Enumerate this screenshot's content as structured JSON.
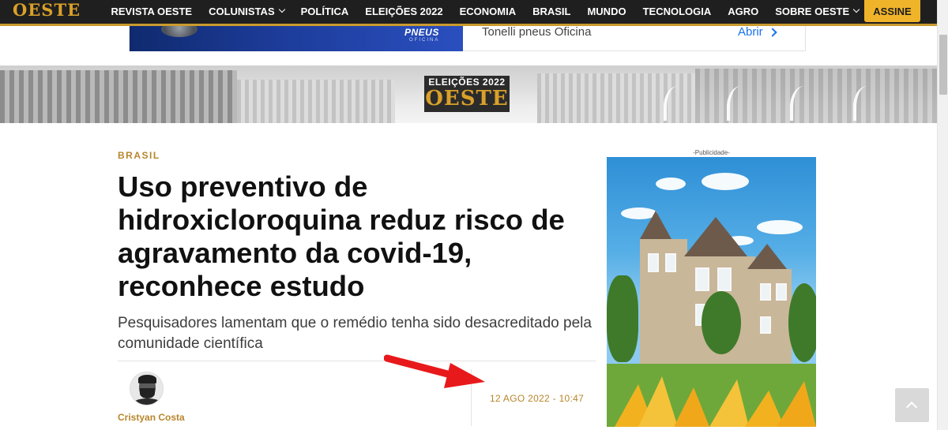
{
  "nav": {
    "logo": "OESTE",
    "items": [
      {
        "label": "REVISTA OESTE",
        "dropdown": false
      },
      {
        "label": "COLUNISTAS",
        "dropdown": true
      },
      {
        "label": "POLÍTICA",
        "dropdown": false
      },
      {
        "label": "ELEIÇÕES 2022",
        "dropdown": false
      },
      {
        "label": "ECONOMIA",
        "dropdown": false
      },
      {
        "label": "BRASIL",
        "dropdown": false
      },
      {
        "label": "MUNDO",
        "dropdown": false
      },
      {
        "label": "TECNOLOGIA",
        "dropdown": false
      },
      {
        "label": "AGRO",
        "dropdown": false
      },
      {
        "label": "SOBRE OESTE",
        "dropdown": true
      }
    ],
    "subscribe_label": "ASSINE"
  },
  "top_ad": {
    "brand": "PNEUS",
    "brand_sub": "OFICINA",
    "text": "Tonelli pneus Oficina",
    "cta": "Abrir"
  },
  "banner": {
    "title": "ELEIÇÕES 2022",
    "logo": "OESTE"
  },
  "article": {
    "category": "BRASIL",
    "headline": "Uso preventivo de hidroxicloroquina reduz risco de agravamento da covid-19, reconhece estudo",
    "subtitle": "Pesquisadores lamentam que o remédio tenha sido desacreditado pela comunidade científica",
    "author": "Cristyan Costa",
    "date": "12 AGO 2022 - 10:47"
  },
  "side_ad": {
    "label": "-Publicidade-",
    "close": "X"
  },
  "colors": {
    "nav_bg": "#1f1f1f",
    "accent": "#c99a2e",
    "subscribe_bg": "#f0b42a",
    "link_blue": "#1a73e8",
    "arrow_red": "#e8191b"
  }
}
